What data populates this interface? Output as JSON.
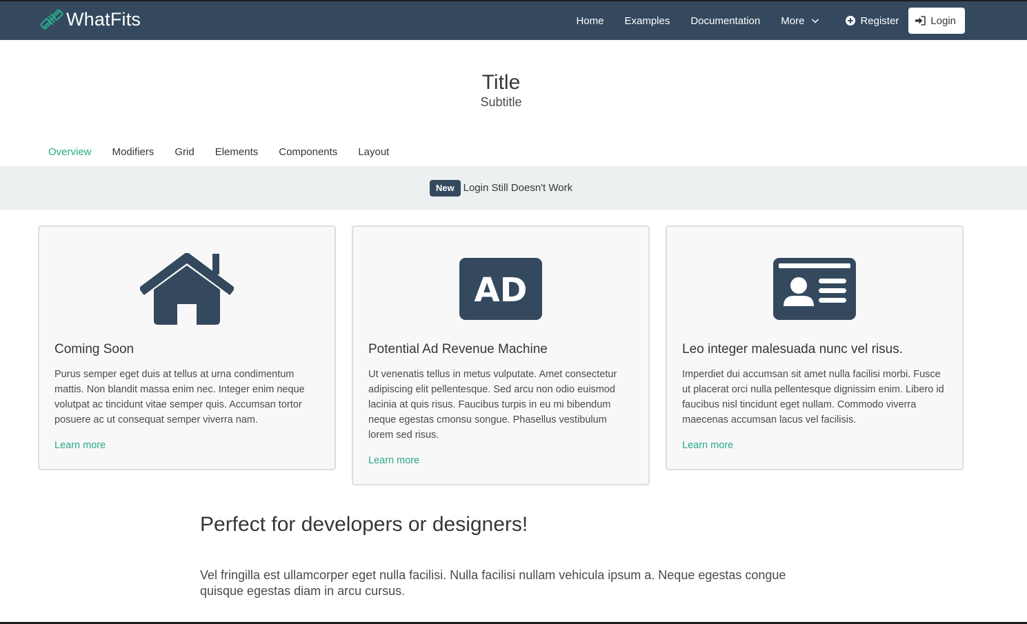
{
  "navbar": {
    "brand": "WhatFits",
    "links": [
      "Home",
      "Examples",
      "Documentation",
      "More"
    ],
    "register_label": "Register",
    "login_label": "Login",
    "background_color": "#34495e"
  },
  "hero": {
    "title": "Title",
    "subtitle": "Subtitle"
  },
  "tabs": {
    "items": [
      "Overview",
      "Modifiers",
      "Grid",
      "Elements",
      "Components",
      "Layout"
    ],
    "active": "Overview",
    "accent_color": "#2aa888"
  },
  "announcement": {
    "badge": "New",
    "text": "Login Still Doesn't Work"
  },
  "cards": [
    {
      "icon": "home-icon",
      "title": "Coming Soon",
      "text": "Purus semper eget duis at tellus at urna condimentum mattis. Non blandit massa enim nec. Integer enim neque volutpat ac tincidunt vitae semper quis. Accumsan tortor posuere ac ut consequat semper viverra nam.",
      "link": "Learn more"
    },
    {
      "icon": "ad-icon",
      "title": "Potential Ad Revenue Machine",
      "text": "Ut venenatis tellus in metus vulputate. Amet consectetur adipiscing elit pellentesque. Sed arcu non odio euismod lacinia at quis risus. Faucibus turpis in eu mi bibendum neque egestas cmonsu songue. Phasellus vestibulum lorem sed risus.",
      "link": "Learn more"
    },
    {
      "icon": "id-card-icon",
      "title": "Leo integer malesuada nunc vel risus.",
      "text": "Imperdiet dui accumsan sit amet nulla facilisi morbi. Fusce ut placerat orci nulla pellentesque dignissim enim. Libero id faucibus nisl tincidunt eget nullam. Commodo viverra maecenas accumsan lacus vel facilisis.",
      "link": "Learn more"
    }
  ],
  "section": {
    "heading": "Perfect for developers or designers!",
    "text": "Vel fringilla est ullamcorper eget nulla facilisi. Nulla facilisi nullam vehicula ipsum a. Neque egestas congue quisque egestas diam in arcu cursus."
  }
}
